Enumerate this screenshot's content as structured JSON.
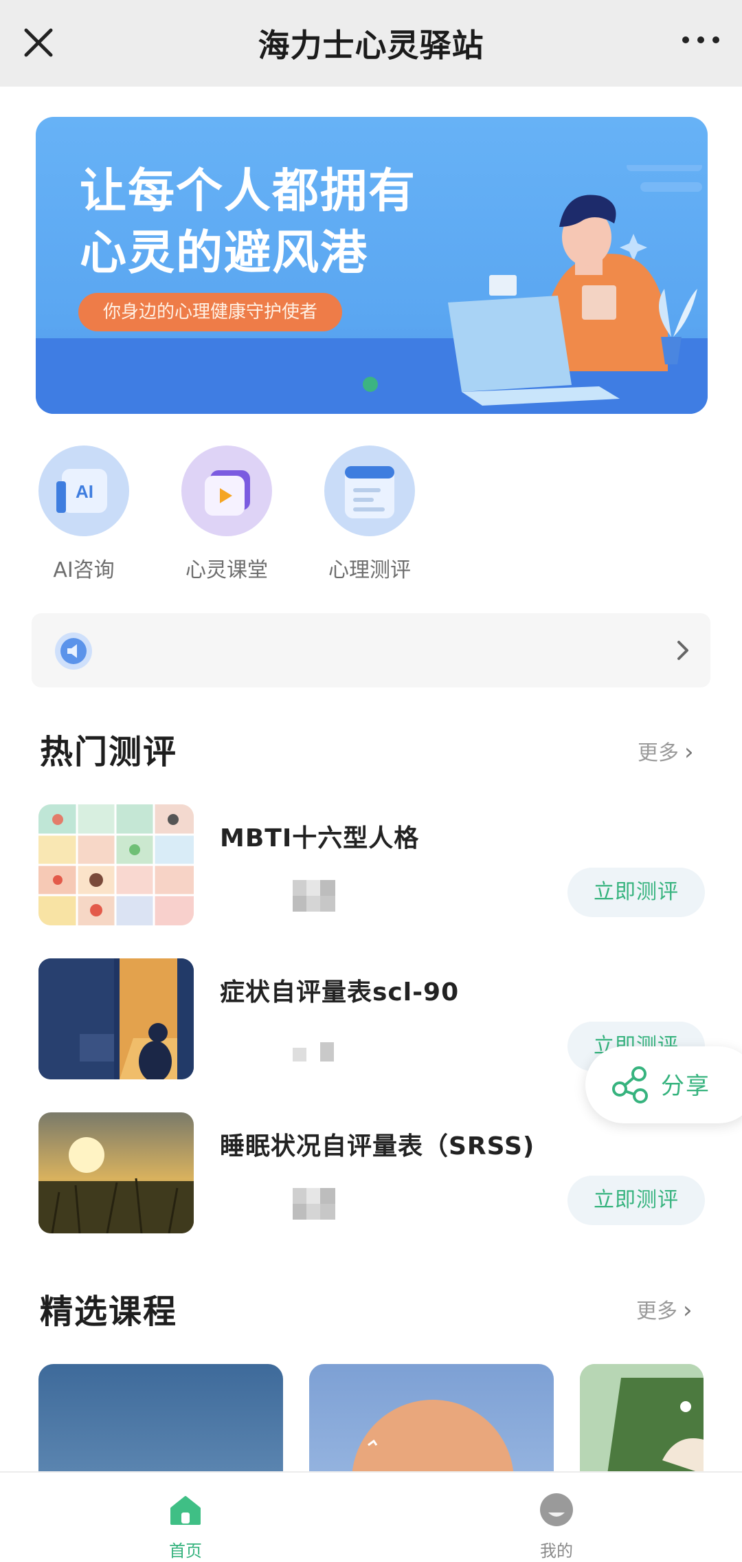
{
  "app": {
    "title": "海力士心灵驿站"
  },
  "banner": {
    "headline_line1": "让每个人都拥有",
    "headline_line2": "心灵的避风港",
    "tagline": "你身边的心理健康守护使者"
  },
  "quick_actions": [
    {
      "label": "AI咨询",
      "icon": "ai-icon",
      "icon_text": "AI"
    },
    {
      "label": "心灵课堂",
      "icon": "video-lesson-icon"
    },
    {
      "label": "心理测评",
      "icon": "document-icon"
    }
  ],
  "hot_section": {
    "title": "热门测评",
    "more": "更多"
  },
  "assessments": [
    {
      "name": "MBTI十六型人格",
      "button": "立即测评"
    },
    {
      "name": "症状自评量表scl-90",
      "button": "立即测评"
    },
    {
      "name": "睡眠状况自评量表（SRSS)",
      "button": "立即测评"
    }
  ],
  "share": {
    "label": "分享"
  },
  "course_section": {
    "title": "精选课程",
    "more": "更多"
  },
  "tabs": [
    {
      "label": "首页",
      "active": true,
      "icon": "home-icon"
    },
    {
      "label": "我的",
      "active": false,
      "icon": "profile-icon"
    }
  ],
  "colors": {
    "accent": "#36b37e",
    "banner_blue": "#5aa6f1",
    "pill_orange": "#ee7c48"
  }
}
